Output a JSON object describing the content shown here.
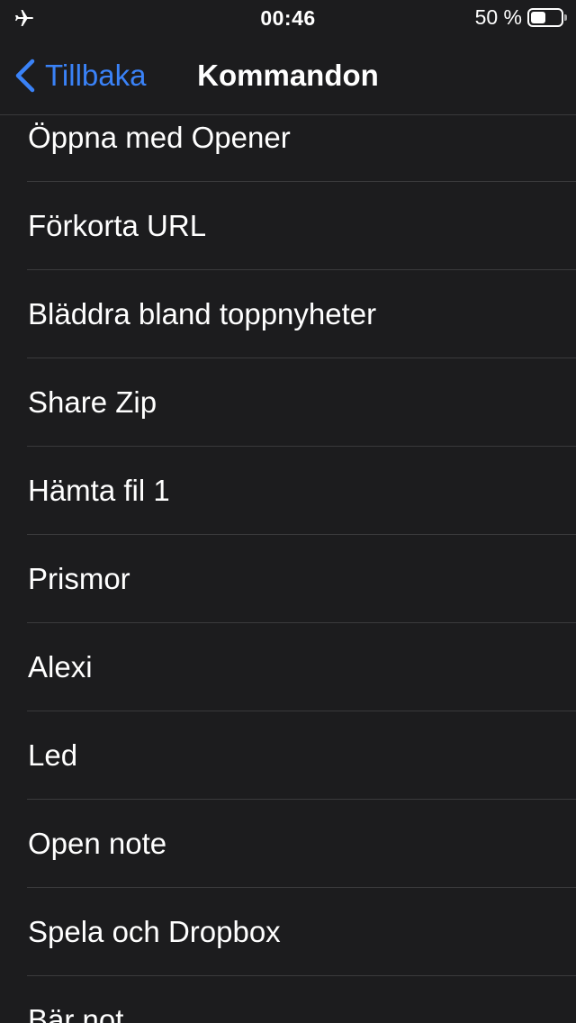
{
  "status_bar": {
    "time": "00:46",
    "battery_percent_label": "50 %",
    "battery_level": 0.5,
    "airplane_icon": "airplane-icon"
  },
  "nav": {
    "back_label": "Tillbaka",
    "title": "Kommandon",
    "accent_color": "#3a82f7"
  },
  "list": {
    "items": [
      "Öppna med Opener",
      "Förkorta URL",
      "Bläddra bland toppnyheter",
      "Share Zip",
      "Hämta fil 1",
      "Prismor",
      "Alexi",
      "Led",
      "Open note",
      "Spela och Dropbox",
      "Bär not"
    ]
  },
  "colors": {
    "background": "#1c1c1e",
    "separator": "#3a3a3c",
    "text": "#ffffff"
  }
}
